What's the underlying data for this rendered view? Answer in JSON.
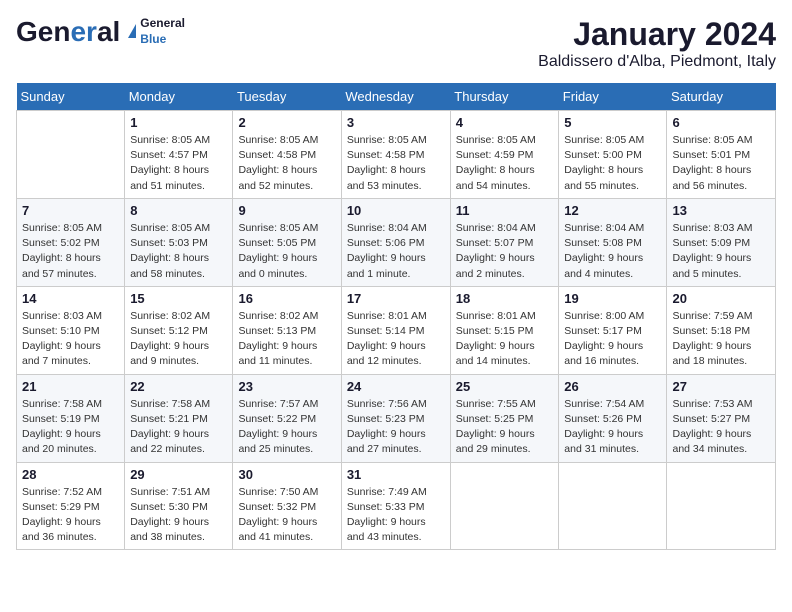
{
  "header": {
    "logo": {
      "general": "General",
      "blue": "Blue"
    },
    "title": "January 2024",
    "location": "Baldissero d'Alba, Piedmont, Italy"
  },
  "calendar": {
    "days_of_week": [
      "Sunday",
      "Monday",
      "Tuesday",
      "Wednesday",
      "Thursday",
      "Friday",
      "Saturday"
    ],
    "weeks": [
      [
        {
          "day": "",
          "info": ""
        },
        {
          "day": "1",
          "info": "Sunrise: 8:05 AM\nSunset: 4:57 PM\nDaylight: 8 hours\nand 51 minutes."
        },
        {
          "day": "2",
          "info": "Sunrise: 8:05 AM\nSunset: 4:58 PM\nDaylight: 8 hours\nand 52 minutes."
        },
        {
          "day": "3",
          "info": "Sunrise: 8:05 AM\nSunset: 4:58 PM\nDaylight: 8 hours\nand 53 minutes."
        },
        {
          "day": "4",
          "info": "Sunrise: 8:05 AM\nSunset: 4:59 PM\nDaylight: 8 hours\nand 54 minutes."
        },
        {
          "day": "5",
          "info": "Sunrise: 8:05 AM\nSunset: 5:00 PM\nDaylight: 8 hours\nand 55 minutes."
        },
        {
          "day": "6",
          "info": "Sunrise: 8:05 AM\nSunset: 5:01 PM\nDaylight: 8 hours\nand 56 minutes."
        }
      ],
      [
        {
          "day": "7",
          "info": "Sunrise: 8:05 AM\nSunset: 5:02 PM\nDaylight: 8 hours\nand 57 minutes."
        },
        {
          "day": "8",
          "info": "Sunrise: 8:05 AM\nSunset: 5:03 PM\nDaylight: 8 hours\nand 58 minutes."
        },
        {
          "day": "9",
          "info": "Sunrise: 8:05 AM\nSunset: 5:05 PM\nDaylight: 9 hours\nand 0 minutes."
        },
        {
          "day": "10",
          "info": "Sunrise: 8:04 AM\nSunset: 5:06 PM\nDaylight: 9 hours\nand 1 minute."
        },
        {
          "day": "11",
          "info": "Sunrise: 8:04 AM\nSunset: 5:07 PM\nDaylight: 9 hours\nand 2 minutes."
        },
        {
          "day": "12",
          "info": "Sunrise: 8:04 AM\nSunset: 5:08 PM\nDaylight: 9 hours\nand 4 minutes."
        },
        {
          "day": "13",
          "info": "Sunrise: 8:03 AM\nSunset: 5:09 PM\nDaylight: 9 hours\nand 5 minutes."
        }
      ],
      [
        {
          "day": "14",
          "info": "Sunrise: 8:03 AM\nSunset: 5:10 PM\nDaylight: 9 hours\nand 7 minutes."
        },
        {
          "day": "15",
          "info": "Sunrise: 8:02 AM\nSunset: 5:12 PM\nDaylight: 9 hours\nand 9 minutes."
        },
        {
          "day": "16",
          "info": "Sunrise: 8:02 AM\nSunset: 5:13 PM\nDaylight: 9 hours\nand 11 minutes."
        },
        {
          "day": "17",
          "info": "Sunrise: 8:01 AM\nSunset: 5:14 PM\nDaylight: 9 hours\nand 12 minutes."
        },
        {
          "day": "18",
          "info": "Sunrise: 8:01 AM\nSunset: 5:15 PM\nDaylight: 9 hours\nand 14 minutes."
        },
        {
          "day": "19",
          "info": "Sunrise: 8:00 AM\nSunset: 5:17 PM\nDaylight: 9 hours\nand 16 minutes."
        },
        {
          "day": "20",
          "info": "Sunrise: 7:59 AM\nSunset: 5:18 PM\nDaylight: 9 hours\nand 18 minutes."
        }
      ],
      [
        {
          "day": "21",
          "info": "Sunrise: 7:58 AM\nSunset: 5:19 PM\nDaylight: 9 hours\nand 20 minutes."
        },
        {
          "day": "22",
          "info": "Sunrise: 7:58 AM\nSunset: 5:21 PM\nDaylight: 9 hours\nand 22 minutes."
        },
        {
          "day": "23",
          "info": "Sunrise: 7:57 AM\nSunset: 5:22 PM\nDaylight: 9 hours\nand 25 minutes."
        },
        {
          "day": "24",
          "info": "Sunrise: 7:56 AM\nSunset: 5:23 PM\nDaylight: 9 hours\nand 27 minutes."
        },
        {
          "day": "25",
          "info": "Sunrise: 7:55 AM\nSunset: 5:25 PM\nDaylight: 9 hours\nand 29 minutes."
        },
        {
          "day": "26",
          "info": "Sunrise: 7:54 AM\nSunset: 5:26 PM\nDaylight: 9 hours\nand 31 minutes."
        },
        {
          "day": "27",
          "info": "Sunrise: 7:53 AM\nSunset: 5:27 PM\nDaylight: 9 hours\nand 34 minutes."
        }
      ],
      [
        {
          "day": "28",
          "info": "Sunrise: 7:52 AM\nSunset: 5:29 PM\nDaylight: 9 hours\nand 36 minutes."
        },
        {
          "day": "29",
          "info": "Sunrise: 7:51 AM\nSunset: 5:30 PM\nDaylight: 9 hours\nand 38 minutes."
        },
        {
          "day": "30",
          "info": "Sunrise: 7:50 AM\nSunset: 5:32 PM\nDaylight: 9 hours\nand 41 minutes."
        },
        {
          "day": "31",
          "info": "Sunrise: 7:49 AM\nSunset: 5:33 PM\nDaylight: 9 hours\nand 43 minutes."
        },
        {
          "day": "",
          "info": ""
        },
        {
          "day": "",
          "info": ""
        },
        {
          "day": "",
          "info": ""
        }
      ]
    ]
  }
}
